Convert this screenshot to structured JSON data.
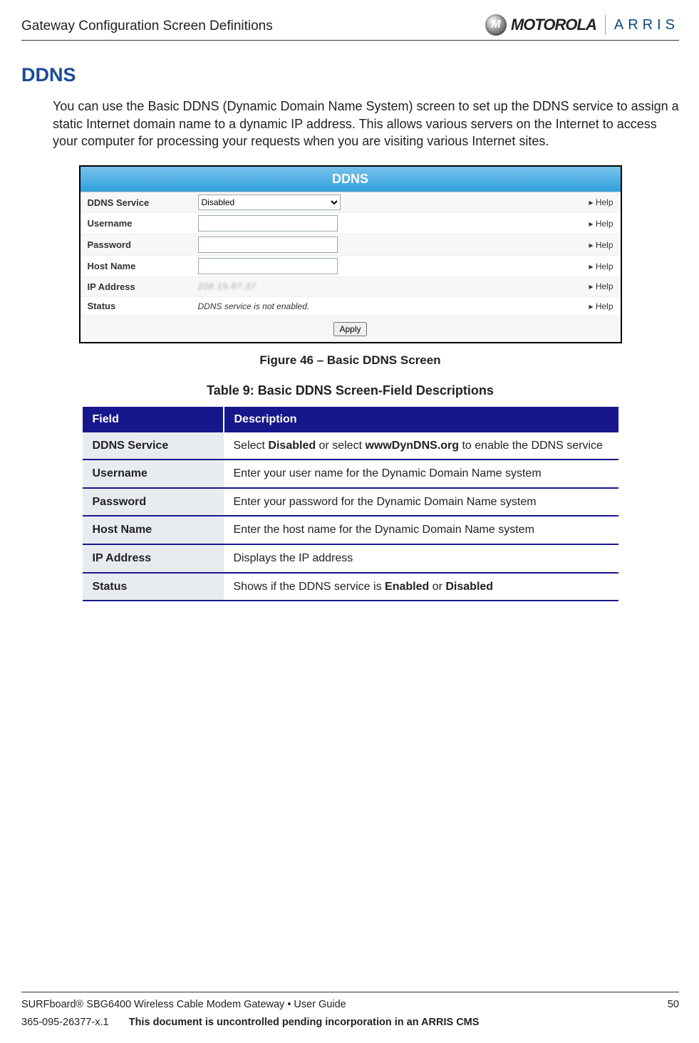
{
  "header": {
    "title": "Gateway Configuration Screen Definitions",
    "logo1": "MOTOROLA",
    "logo2": "ARRIS"
  },
  "section_title": "DDNS",
  "intro": "You can use the Basic DDNS (Dynamic Domain Name System) screen to set up the DDNS service to assign a static Internet domain name to a dynamic IP address. This allows various servers on the Internet to access your computer for processing your requests when you are visiting various Internet sites.",
  "screenshot": {
    "panel_title": "DDNS",
    "rows": [
      {
        "label": "DDNS Service",
        "type": "select",
        "value": "Disabled",
        "help": "Help"
      },
      {
        "label": "Username",
        "type": "text",
        "value": "",
        "help": "Help"
      },
      {
        "label": "Password",
        "type": "password",
        "value": "",
        "help": "Help"
      },
      {
        "label": "Host Name",
        "type": "text",
        "value": "",
        "help": "Help"
      },
      {
        "label": "IP Address",
        "type": "static-ip",
        "value": "208.19.87.37",
        "help": "Help"
      },
      {
        "label": "Status",
        "type": "static",
        "value": "DDNS service is not enabled.",
        "help": "Help"
      }
    ],
    "apply_label": "Apply"
  },
  "figure_caption": "Figure 46 – Basic DDNS Screen",
  "table_caption": "Table 9: Basic DDNS Screen-Field Descriptions",
  "table": {
    "headers": {
      "field": "Field",
      "description": "Description"
    },
    "rows": [
      {
        "field": "DDNS Service",
        "desc_parts": [
          "Select ",
          "Disabled",
          " or select ",
          "wwwDynDNS.org",
          " to enable the DDNS service"
        ]
      },
      {
        "field": "Username",
        "desc": "Enter your user name for the Dynamic Domain Name system"
      },
      {
        "field": "Password",
        "desc": "Enter your password for the Dynamic Domain Name system"
      },
      {
        "field": "Host Name",
        "desc": "Enter the host name for the Dynamic Domain Name system"
      },
      {
        "field": "IP Address",
        "desc": "Displays the IP address"
      },
      {
        "field": "Status",
        "desc_parts": [
          "Shows if the DDNS service is ",
          "Enabled",
          " or ",
          "Disabled",
          ""
        ]
      }
    ]
  },
  "footer": {
    "product": "SURFboard® SBG6400 Wireless Cable Modem Gateway",
    "doc_type": "User Guide",
    "page_number": "50",
    "doc_id": "365-095-26377-x.1",
    "notice": "This document is uncontrolled pending incorporation in an ARRIS CMS"
  }
}
